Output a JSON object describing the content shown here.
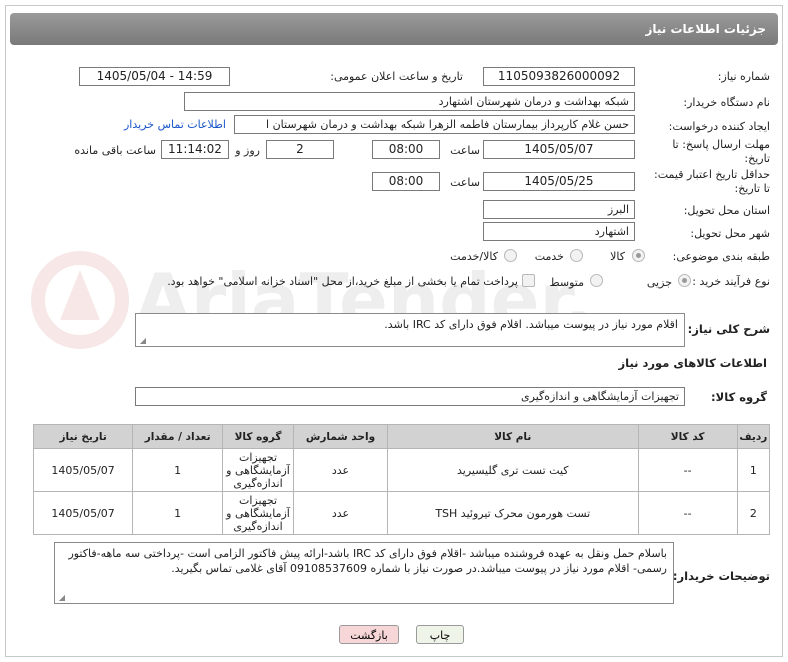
{
  "header": {
    "title": "جزئیات اطلاعات نیاز"
  },
  "need_number": {
    "label": "شماره نیاز:",
    "value": "1105093826000092"
  },
  "announce": {
    "label": "تاریخ و ساعت اعلان عمومی:",
    "value": "1405/05/04 - 14:59"
  },
  "buyer_org": {
    "label": "نام دستگاه خریدار:",
    "value": "شبکه بهداشت و درمان شهرستان اشتهارد"
  },
  "creator": {
    "label": "ایجاد کننده درخواست:",
    "value": "حسن غلام کارپرداز بیمارستان فاطمه الزهرا شبکه بهداشت و درمان شهرستان ا",
    "contact_link": "اطلاعات تماس خریدار"
  },
  "deadline": {
    "label_line1": "مهلت ارسال پاسخ: تا",
    "label_line2": "تاریخ:",
    "date": "1405/05/07",
    "time_label": "ساعت",
    "time": "08:00",
    "days": "2",
    "days_label": "روز و",
    "remaining": "11:14:02",
    "remaining_label": "ساعت باقی مانده"
  },
  "validity": {
    "label_line1": "حداقل تاریخ اعتبار قیمت:",
    "label_line2": "تا تاریخ:",
    "date": "1405/05/25",
    "time_label": "ساعت",
    "time": "08:00"
  },
  "province": {
    "label": "استان محل تحویل:",
    "value": "البرز"
  },
  "city": {
    "label": "شهر محل تحویل:",
    "value": "اشتهارد"
  },
  "category": {
    "label": "طبقه بندی موضوعی:",
    "options": [
      "کالا",
      "خدمت",
      "کالا/خدمت"
    ],
    "selected": 0
  },
  "process": {
    "label": "نوع فرآیند خرید :",
    "options": [
      "جزیی",
      "متوسط"
    ],
    "selected": 0,
    "payment_note": "پرداخت تمام یا بخشی از مبلغ خرید،از محل \"اسناد خزانه اسلامی\" خواهد بود."
  },
  "description": {
    "label": "شرح کلی نیاز:",
    "value": "اقلام مورد نیاز در پیوست میباشد. اقلام فوق دارای کد IRC باشد."
  },
  "goods_info": {
    "title": "اطلاعات کالاهای مورد نیاز"
  },
  "goods_group": {
    "label": "گروه کالا:",
    "value": "تجهیزات آزمایشگاهی و اندازه‌گیری"
  },
  "table": {
    "headers": [
      "ردیف",
      "کد کالا",
      "نام کالا",
      "واحد شمارش",
      "گروه کالا",
      "تعداد / مقدار",
      "تاریخ نیاز"
    ],
    "rows": [
      [
        "1",
        "--",
        "کیت تست تری گلیسیرید",
        "عدد",
        "تجهیزات آزمایشگاهی و اندازه‌گیری",
        "1",
        "1405/05/07"
      ],
      [
        "2",
        "--",
        "تست هورمون محرک تیروئید TSH",
        "عدد",
        "تجهیزات آزمایشگاهی و اندازه‌گیری",
        "1",
        "1405/05/07"
      ]
    ]
  },
  "buyer_notes": {
    "label": "توضیحات خریدار:",
    "value": "باسلام حمل ونقل به عهده فروشنده میباشد -اقلام فوق دارای کد IRC باشد-ارائه پیش فاکتور الزامی است -پرداختی سه ماهه-فاکتور رسمی- اقلام مورد نیاز در پیوست میباشد.در صورت نیاز با شماره 09108537609 آقای غلامی تماس بگیرید."
  },
  "buttons": {
    "print": "چاپ",
    "back": "بازگشت"
  },
  "watermark": {
    "text": "AriaTender.net"
  },
  "colors": {
    "header_bg": "#8a8a8a",
    "link": "#1a56c8",
    "back_button_bg": "#f6d6d6",
    "print_button_bg": "#eef4e8"
  }
}
